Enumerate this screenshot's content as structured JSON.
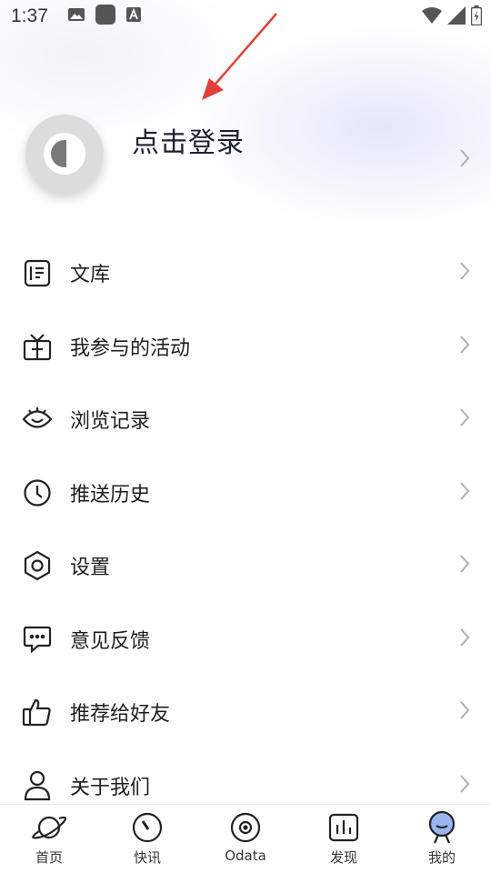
{
  "status_bar": {
    "time": "1:37",
    "left_icons": [
      "image-icon",
      "app-icon",
      "a-badge-icon"
    ],
    "right_icons": [
      "wifi-icon",
      "signal-icon",
      "battery-icon"
    ]
  },
  "profile": {
    "login_label": "点击登录",
    "avatar_icon": "avatar-placeholder-icon"
  },
  "menu": {
    "items": [
      {
        "label": "文库",
        "icon": "library-icon"
      },
      {
        "label": "我参与的活动",
        "icon": "gift-icon"
      },
      {
        "label": "浏览记录",
        "icon": "eye-icon"
      },
      {
        "label": "推送历史",
        "icon": "clock-icon"
      },
      {
        "label": "设置",
        "icon": "hexagon-settings-icon"
      },
      {
        "label": "意见反馈",
        "icon": "chat-bubble-icon"
      },
      {
        "label": "推荐给好友",
        "icon": "thumbs-up-icon"
      },
      {
        "label": "关于我们",
        "icon": "person-icon"
      }
    ]
  },
  "tabbar": {
    "tabs": [
      {
        "label": "首页",
        "icon": "planet-icon"
      },
      {
        "label": "快讯",
        "icon": "gauge-icon"
      },
      {
        "label": "Odata",
        "icon": "disc-icon"
      },
      {
        "label": "发现",
        "icon": "bar-chart-icon"
      },
      {
        "label": "我的",
        "icon": "profile-avatar-icon",
        "active": true
      }
    ]
  },
  "colors": {
    "annotation_arrow": "#e0403a",
    "text_primary": "#1e1e1e",
    "chevron": "#b0b0b0",
    "active_tab_accent": "#9bb5f2"
  }
}
